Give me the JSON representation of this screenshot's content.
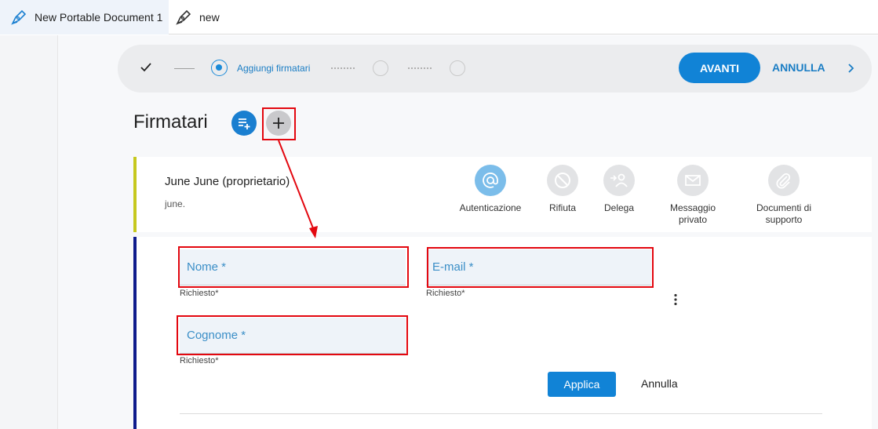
{
  "tabs": [
    {
      "label": "New Portable Document 1",
      "icon": "pen-icon",
      "active": true
    },
    {
      "label": "new",
      "icon": "pen-icon",
      "active": false
    }
  ],
  "stepper": {
    "current_step_label": "Aggiungi firmatari",
    "next_label": "AVANTI",
    "cancel_label": "ANNULLA"
  },
  "section": {
    "title": "Firmatari"
  },
  "owner": {
    "name": "June June (proprietario)",
    "email": "june.",
    "actions": [
      {
        "label": "Autenticazione",
        "icon": "at-icon",
        "active": true
      },
      {
        "label": "Rifiuta",
        "icon": "block-icon",
        "active": false
      },
      {
        "label": "Delega",
        "icon": "delegate-icon",
        "active": false
      },
      {
        "label": "Messaggio privato",
        "icon": "mail-icon",
        "active": false
      },
      {
        "label": "Documenti di supporto",
        "icon": "paperclip-icon",
        "active": false
      }
    ]
  },
  "form": {
    "nome_placeholder": "Nome *",
    "email_placeholder": "E-mail *",
    "cognome_placeholder": "Cognome *",
    "required_hint": "Richiesto*",
    "apply_label": "Applica",
    "cancel_label": "Annulla"
  },
  "colors": {
    "accent": "#1183d6",
    "highlight": "#e3070f",
    "owner_bar": "#c6c81e",
    "form_bar": "#0f1b8c"
  }
}
